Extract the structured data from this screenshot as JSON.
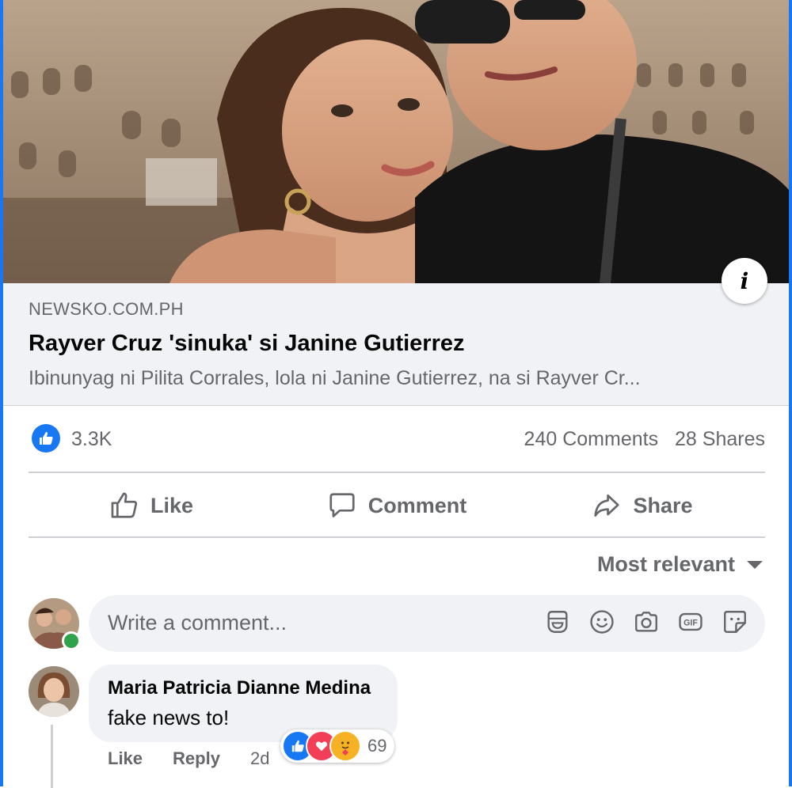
{
  "link_preview": {
    "domain": "NEWSKO.COM.PH",
    "title": "Rayver Cruz 'sinuka' si Janine Gutierrez",
    "description": "Ibinunyag ni Pilita Corrales, lola ni Janine Gutierrez, na si Rayver Cr..."
  },
  "summary": {
    "reaction_count": "3.3K",
    "comments": "240 Comments",
    "shares": "28 Shares"
  },
  "actions": {
    "like": "Like",
    "comment": "Comment",
    "share": "Share"
  },
  "sort": {
    "label": "Most relevant"
  },
  "composer": {
    "placeholder": "Write a comment..."
  },
  "comment": {
    "author": "Maria Patricia Dianne Medina",
    "text": "fake news to!",
    "reaction_count": "69",
    "like_label": "Like",
    "reply_label": "Reply",
    "time": "2d"
  },
  "colors": {
    "accent": "#1877f2",
    "secondary_text": "#65676b",
    "bubble_bg": "#f0f2f5",
    "online": "#31a24c"
  }
}
